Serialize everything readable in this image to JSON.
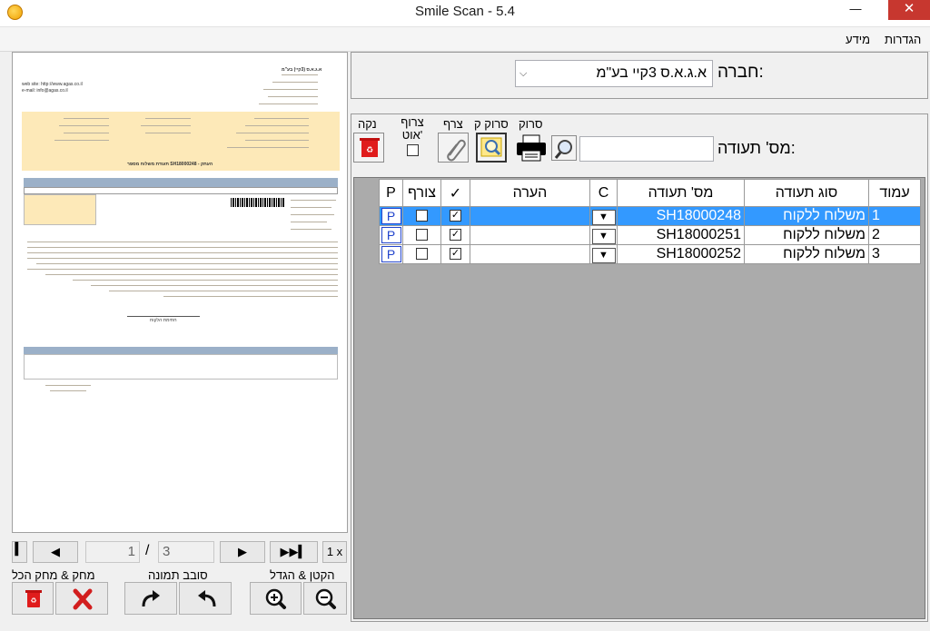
{
  "window": {
    "title": "Smile Scan - 5.4",
    "minimize": "—",
    "maximize": "☐",
    "close": "✕"
  },
  "menu": {
    "settings": "הגדרות",
    "info": "מידע"
  },
  "preview": {
    "current_page": "1",
    "separator": "/",
    "total_pages": "3",
    "zoom": "1 x",
    "label_zoom": "הקטן & הגדל",
    "label_rotate": "סובב תמונה",
    "label_delete": "מחק & מחק הכל",
    "doc": {
      "web": "web site: http://www.agas.co.il",
      "email": "e-mail: info@agas.co.il",
      "company": "א.ג.א.ס (3קיי) בע\"מ",
      "title_line": "תעודת משלוח מספר SH18000248 - העתק",
      "signature": "חתימת הלקוח"
    }
  },
  "company": {
    "label": "חברה:",
    "value": "א.ג.א.ס 3קיי בע\"מ"
  },
  "tools": {
    "clear_label": "נקה",
    "attach_auto_label": "צרוף אוט'",
    "attach_label": "צרף",
    "scan_q_label": "סרוק ק",
    "scan_label": "סרוק",
    "doc_number_label": "מס' תעודה:"
  },
  "grid": {
    "columns": [
      "P",
      "צורף",
      "✓",
      "הערה",
      "C",
      "מס' תעודה",
      "סוג תעודה",
      "עמוד"
    ],
    "rows": [
      {
        "page": "1",
        "type": "משלוח ללקוח",
        "number": "SH18000248",
        "note": "",
        "attached": false,
        "checked": true,
        "p": "P",
        "selected": true
      },
      {
        "page": "2",
        "type": "משלוח ללקוח",
        "number": "SH18000251",
        "note": "",
        "attached": false,
        "checked": true,
        "p": "P",
        "selected": false
      },
      {
        "page": "3",
        "type": "משלוח ללקוח",
        "number": "SH18000252",
        "note": "",
        "attached": false,
        "checked": true,
        "p": "P",
        "selected": false
      }
    ]
  }
}
